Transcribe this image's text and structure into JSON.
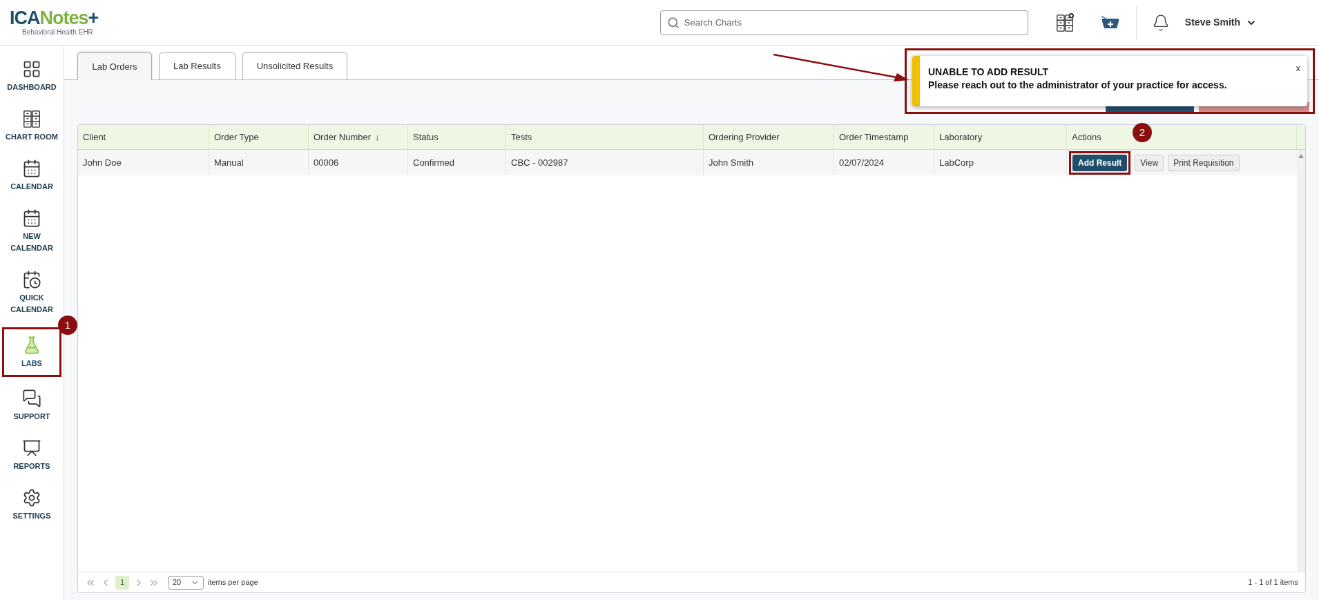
{
  "header": {
    "logo": {
      "brand_dark": "ICA",
      "brand_green": "Notes",
      "plus": "+",
      "tagline": "Behavioral Health EHR"
    },
    "search": {
      "placeholder": "Search Charts"
    },
    "user": {
      "name": "Steve Smith"
    }
  },
  "sidebar": {
    "items": [
      {
        "label": "DASHBOARD",
        "selected": false,
        "annotated": false
      },
      {
        "label": "CHART ROOM",
        "selected": false,
        "annotated": false
      },
      {
        "label": "CALENDAR",
        "selected": false,
        "annotated": false
      },
      {
        "label": "NEW CALENDAR",
        "selected": false,
        "annotated": false
      },
      {
        "label": "QUICK CALENDAR",
        "selected": false,
        "annotated": false
      },
      {
        "label": "LABS",
        "selected": true,
        "annotated": true
      },
      {
        "label": "SUPPORT",
        "selected": false,
        "annotated": false
      },
      {
        "label": "REPORTS",
        "selected": false,
        "annotated": false
      },
      {
        "label": "SETTINGS",
        "selected": false,
        "annotated": false
      }
    ]
  },
  "tabs": [
    {
      "label": "Lab Orders",
      "selected": true
    },
    {
      "label": "Lab Results",
      "selected": false
    },
    {
      "label": "Unsolicited Results",
      "selected": false
    }
  ],
  "toast": {
    "title": "UNABLE TO ADD RESULT",
    "message": "Please reach out to the administrator of your practice for access.",
    "close": "x",
    "annotated": true
  },
  "table": {
    "columns": [
      {
        "label": "Client"
      },
      {
        "label": "Order Type"
      },
      {
        "label": "Order Number",
        "sort": "↓"
      },
      {
        "label": "Status"
      },
      {
        "label": "Tests"
      },
      {
        "label": "Ordering Provider"
      },
      {
        "label": "Order Timestamp"
      },
      {
        "label": "Laboratory"
      },
      {
        "label": "Actions"
      }
    ],
    "rows": [
      {
        "cells": [
          "John Doe",
          "Manual",
          "00006",
          "Confirmed",
          "CBC - 002987",
          "John Smith",
          "02/07/2024",
          "LabCorp"
        ],
        "actions": [
          {
            "label": "Add Result",
            "kind": "primary",
            "annotated": true
          },
          {
            "label": "View",
            "kind": "secondary",
            "annotated": false
          },
          {
            "label": "Print Requisition",
            "kind": "secondary",
            "annotated": false
          }
        ]
      }
    ]
  },
  "pager": {
    "pages": [
      {
        "label": "1",
        "selected": true
      }
    ],
    "page_size": "20",
    "page_size_label": "items per page",
    "summary": "1 - 1 of 1 items"
  },
  "markers": [
    {
      "label": "1"
    },
    {
      "label": "2"
    }
  ]
}
